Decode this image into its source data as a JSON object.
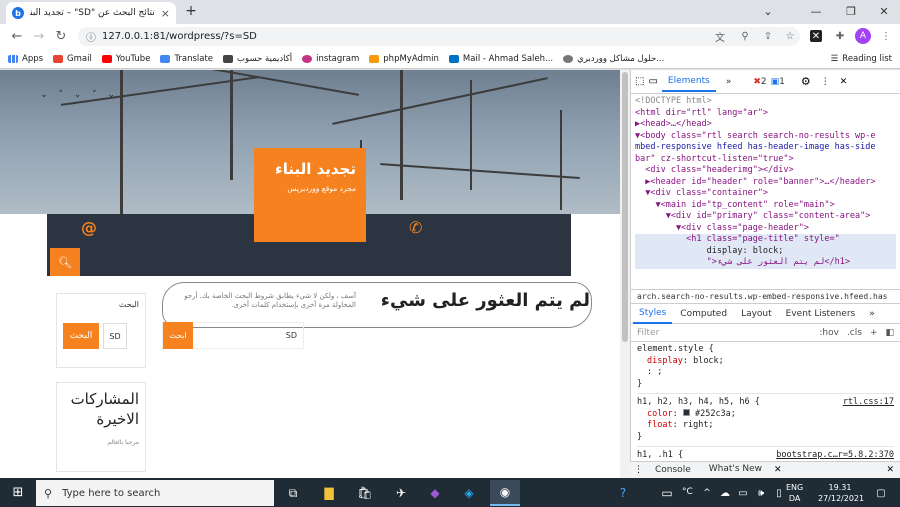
{
  "browser": {
    "tab_title": "نتائج البحث عن \"SD\" – تجديد البناء",
    "tab_close": "×",
    "new_tab": "+",
    "url": "127.0.0.1:81/wordpress/?s=SD",
    "avatar_letter": "A",
    "bookmarks": [
      {
        "label": "Apps",
        "color": "#5f6368"
      },
      {
        "label": "Gmail",
        "color": "#ea4335"
      },
      {
        "label": "YouTube",
        "color": "#ff0000"
      },
      {
        "label": "Translate",
        "color": "#4285f4"
      },
      {
        "label": "أكاديمية حسوب",
        "color": "#444444"
      },
      {
        "label": "instagram",
        "color": "#c13584"
      },
      {
        "label": "phpMyAdmin",
        "color": "#f89c0e"
      },
      {
        "label": "Mail - Ahmad Saleh...",
        "color": "#0072c6"
      },
      {
        "label": "حلول مشاكل ووردبري...",
        "color": "#777777"
      }
    ],
    "reading_list": "Reading list"
  },
  "site": {
    "title": "تجديد البناء",
    "description": "مجرد موقع ووردبريس",
    "at_icon": "@",
    "phone_icon": "✆",
    "not_found_heading": "لم يتم العثور على شيء",
    "not_found_text": "آسف ، ولكن لا شيء يطابق شروط البحث الخاصة بك. أرجو المحاولة مرة أخرى بإستخدام كلمات أخرى.",
    "search_value": "SD",
    "search_button": "ابحث",
    "widget_search_title": "البحث",
    "widget_search_value": "SD",
    "widget_search_button": "البحث",
    "recent_posts_title": "المشاركات الاخيرة",
    "recent_post_1": "مرحبا بالعالم"
  },
  "devtools": {
    "tabs": [
      "Elements",
      "»"
    ],
    "errors": "2",
    "messages": "1",
    "dom_lines": [
      "<!DOCTYPE html>",
      "<html dir=\"rtl\" lang=\"ar\">",
      "▶<head>…</head>",
      "▼<body class=\"rtl search search-no-results wp-e",
      "mbed-responsive hfeed has-header-image has-side",
      "bar\" cz-shortcut-listen=\"true\">",
      "  <div class=\"headerimg\"></div>",
      "  ▶<header id=\"header\" role=\"banner\">…</header>",
      "  ▼<div class=\"container\">",
      "    ▼<main id=\"tp_content\" role=\"main\">",
      "      ▼<div id=\"primary\" class=\"content-area\">",
      "        ▼<div class=\"page-header\">",
      "          <h1 class=\"page-title\" style=\"",
      "              display: block;",
      "              \">لم يتم العثور على شيء</h1>"
    ],
    "breadcrumb": "arch.search-no-results.wp-embed-responsive.hfeed.has",
    "style_tabs": [
      "Styles",
      "Computed",
      "Layout",
      "Event Listeners",
      "»"
    ],
    "filter_placeholder": "Filter",
    "hov": ":hov",
    "cls": ".cls",
    "rules": [
      {
        "selector": "element.style {",
        "props": [
          [
            "display",
            "block;"
          ],
          [
            "",
            ";"
          ]
        ],
        "source": "",
        "end": "}"
      },
      {
        "selector": "h1, h2, h3, h4, h5, h6 {",
        "props": [
          [
            "color",
            "#252c3a;"
          ],
          [
            "float",
            "right;"
          ]
        ],
        "source": "rtl.css:17",
        "end": "}"
      },
      {
        "selector": "h1, .h1 {",
        "props": [],
        "source": "bootstrap.c…r=5.8.2:370",
        "end": ""
      }
    ],
    "drawer_tabs": [
      "Console",
      "What's New"
    ]
  },
  "taskbar": {
    "search_placeholder": "Type here to search",
    "lang_top": "ENG",
    "lang_bottom": "DA",
    "time": "19.31",
    "date": "27/12/2021",
    "temp": "°C"
  }
}
